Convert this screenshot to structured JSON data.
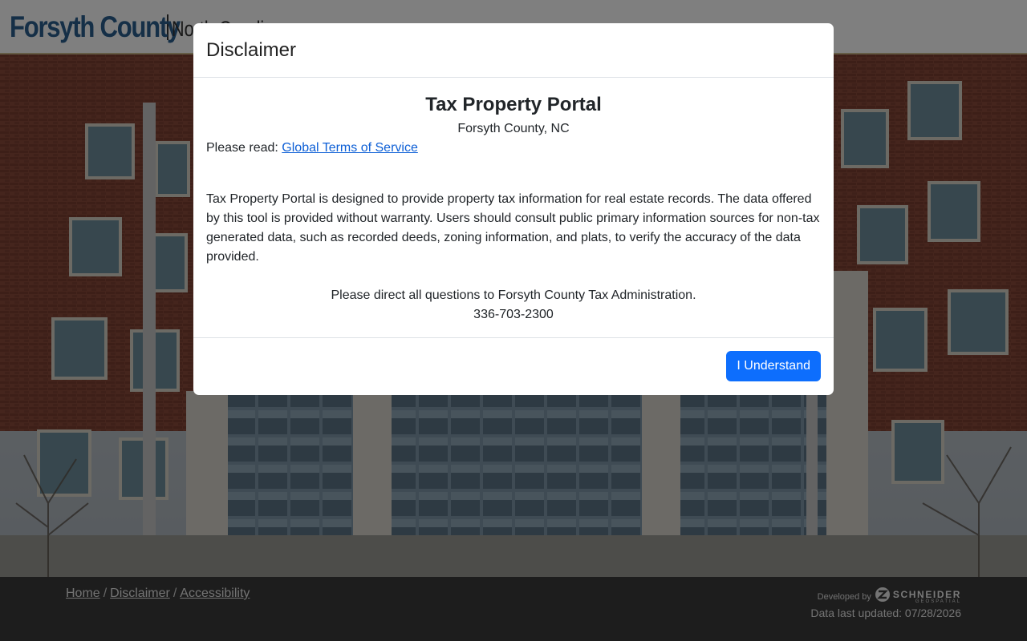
{
  "header": {
    "brand_main": "Forsyth County",
    "brand_sub": "North Carolina"
  },
  "modal": {
    "title": "Disclaimer",
    "portal_title": "Tax Property Portal",
    "portal_subtitle": "Forsyth County, NC",
    "please_read_prefix": "Please read:",
    "terms_link": "Global Terms of Service",
    "body_text": "Tax Property Portal is designed to provide property tax information for real estate records. The data offered by this tool is provided without warranty. Users should consult public primary information sources for non-tax generated data, such as recorded deeds, zoning information, and plats, to verify the accuracy of the data provided.",
    "contact_line": "Please direct all questions to Forsyth County Tax Administration.",
    "phone": "336-703-2300",
    "button_label": "I Understand"
  },
  "footer": {
    "links": [
      "Home",
      "Disclaimer",
      "Accessibility"
    ],
    "separator": "/",
    "developed_by": "Developed by",
    "developer_name": "SCHNEIDER",
    "developer_sub": "GEOSPATIAL",
    "data_updated": "Data last updated: 07/28/2026"
  },
  "colors": {
    "brand_blue": "#2a5f8e",
    "primary_button": "#0d6efd",
    "link": "#0d5fd6",
    "header_border": "#c9b98a"
  },
  "icons": [
    "schneider-logo-icon"
  ]
}
